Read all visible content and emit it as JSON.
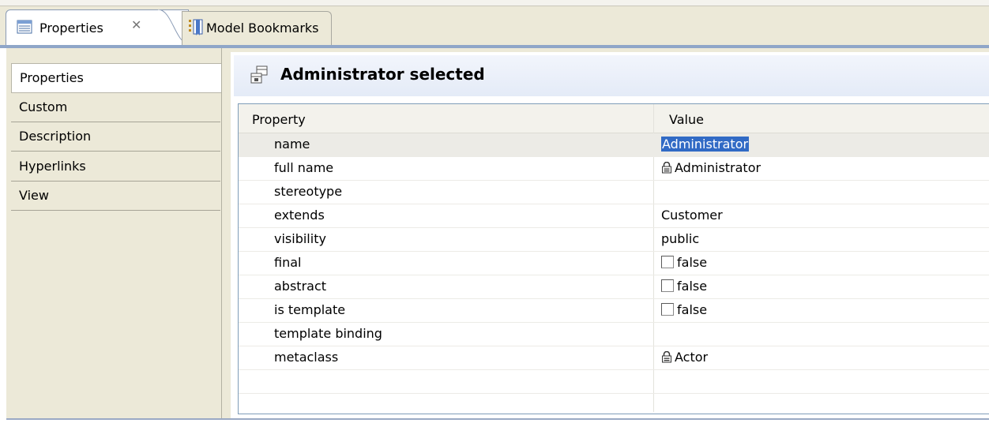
{
  "tabs": {
    "properties_label": "Properties",
    "close_glyph": "✕",
    "bookmarks_label": "Model Bookmarks"
  },
  "sidebar": {
    "items": [
      {
        "label": "Properties",
        "selected": true
      },
      {
        "label": "Custom"
      },
      {
        "label": "Description"
      },
      {
        "label": "Hyperlinks"
      },
      {
        "label": "View"
      }
    ]
  },
  "header": {
    "title": "Administrator selected",
    "icon": "class-element-icon"
  },
  "table": {
    "columns": [
      "Property",
      "Value"
    ],
    "rows": [
      {
        "property": "name",
        "value": "Administrator",
        "kind": "editing"
      },
      {
        "property": "full name",
        "value": "Administrator",
        "kind": "locked"
      },
      {
        "property": "stereotype",
        "value": "",
        "kind": "text"
      },
      {
        "property": "extends",
        "value": "Customer",
        "kind": "text"
      },
      {
        "property": "visibility",
        "value": "public",
        "kind": "text"
      },
      {
        "property": "final",
        "value": "false",
        "kind": "checkbox"
      },
      {
        "property": "abstract",
        "value": "false",
        "kind": "checkbox"
      },
      {
        "property": "is template",
        "value": "false",
        "kind": "checkbox"
      },
      {
        "property": "template binding",
        "value": "",
        "kind": "text"
      },
      {
        "property": "metaclass",
        "value": "Actor",
        "kind": "locked"
      }
    ]
  },
  "colors": {
    "panel_bg": "#ece9d8",
    "header_band": "#e4ebf7",
    "selection": "#316ac5",
    "tab_border": "#8fa6c8"
  }
}
